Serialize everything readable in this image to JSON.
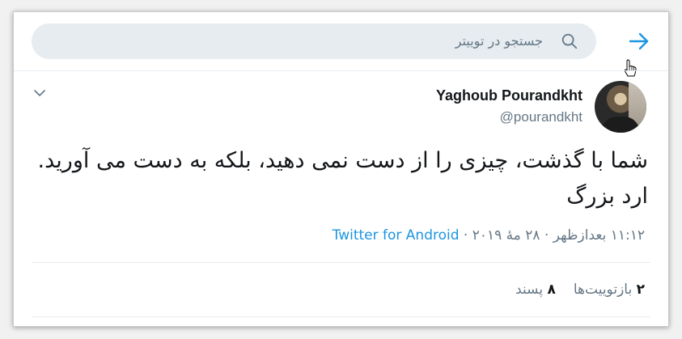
{
  "search": {
    "placeholder": "جستجو در توییتر"
  },
  "tweet": {
    "author": {
      "display_name": "Yaghoub Pourandkht",
      "handle": "@pourandkht"
    },
    "text": "شما با گذشت، چیزی را از دست نمی دهید، بلکه به دست می آورید. ارد بزرگ",
    "time": "۱۱:۱۲ بعدازظهر",
    "date": "۲۸ مهٔ ۲۰۱۹",
    "separator": "·",
    "source": "Twitter for Android",
    "retweets": {
      "count": "۲",
      "label": "بازتوییت‌ها"
    },
    "likes": {
      "count": "۸",
      "label": "پسند"
    }
  },
  "colors": {
    "accent": "#1b95e0",
    "muted_text": "#657786",
    "search_bg": "#e6ecf0"
  },
  "icons": {
    "back": "arrow-right-icon",
    "search": "search-icon",
    "caret": "chevron-down-icon",
    "cursor": "hand-pointer-icon"
  }
}
